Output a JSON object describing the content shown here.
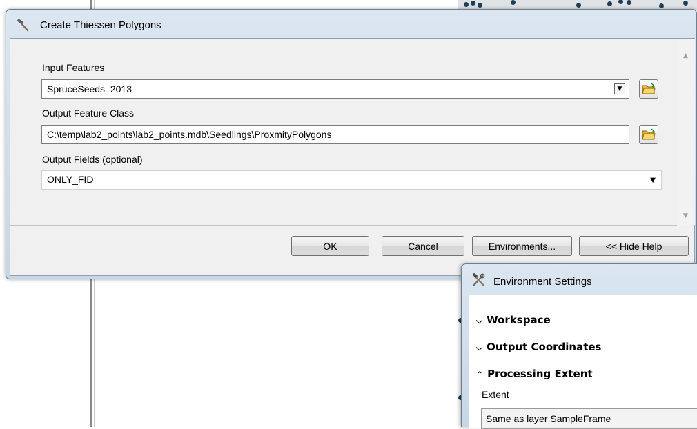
{
  "main_dialog": {
    "title": "Create Thiessen Polygons",
    "fields": [
      {
        "label": "Input Features",
        "value": "SpruceSeeds_2013"
      },
      {
        "label": "Output Feature Class",
        "value": "C:\\temp\\lab2_points\\lab2_points.mdb\\Seedlings\\ProxmityPolygons"
      },
      {
        "label": "Output Fields (optional)",
        "value": "ONLY_FID"
      }
    ],
    "buttons": {
      "ok": "OK",
      "cancel": "Cancel",
      "environments": "Environments...",
      "hide_help": "<< Hide Help"
    }
  },
  "environment_dialog": {
    "title": "Environment Settings",
    "sections": [
      {
        "label": "Workspace",
        "state": "collapsed"
      },
      {
        "label": "Output Coordinates",
        "state": "collapsed"
      },
      {
        "label": "Processing Extent",
        "state": "expanded"
      }
    ],
    "extent_label": "Extent",
    "extent_value": "Same as layer SampleFrame"
  },
  "icons": {
    "title_icon": "hammer-icon",
    "env_title_icon": "tools-icon",
    "browse_icon": "folder-open-icon"
  },
  "colors": {
    "title_gradient_top": "#dbe6f1",
    "title_gradient_bottom": "#c7d6e6",
    "client_bg": "#f0f0f0",
    "map_point": "#1e3f5a"
  }
}
